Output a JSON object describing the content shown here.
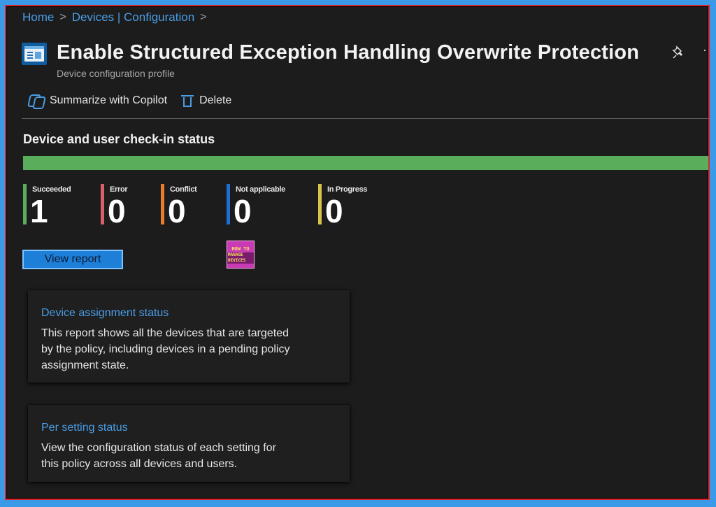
{
  "breadcrumb": {
    "items": [
      "Home",
      "Devices | Configuration"
    ],
    "separator": ">"
  },
  "header": {
    "title": "Enable Structured Exception Handling Overwrite Protection",
    "subtitle": "Device configuration profile",
    "icon": "device-configuration-profile-icon"
  },
  "toolbar": {
    "copilot_label": "Summarize with Copilot",
    "delete_label": "Delete"
  },
  "checkin": {
    "section_title": "Device and user check-in status",
    "progress_succeeded_fraction": 1.0,
    "stats": [
      {
        "label": "Succeeded",
        "value": "1",
        "color": "#5aad5a"
      },
      {
        "label": "Error",
        "value": "0",
        "color": "#d9616b"
      },
      {
        "label": "Conflict",
        "value": "0",
        "color": "#e87d2f"
      },
      {
        "label": "Not applicable",
        "value": "0",
        "color": "#1f6fd6"
      },
      {
        "label": "In Progress",
        "value": "0",
        "color": "#d9c24a"
      }
    ],
    "view_report_label": "View report"
  },
  "logo": {
    "line1": "HOW TO",
    "line2": "MANAGE DEVICES"
  },
  "cards": [
    {
      "title": "Device assignment status",
      "description": "This report shows all the devices that are targeted by the policy, including devices in a pending policy assignment state."
    },
    {
      "title": "Per setting status",
      "description": "View the configuration status of each setting for this policy across all devices and users."
    }
  ],
  "colors": {
    "accent": "#4a9de6",
    "background": "#1c1c1c",
    "frame_border": "#d9262b",
    "outer_background": "#3b9ae8"
  }
}
